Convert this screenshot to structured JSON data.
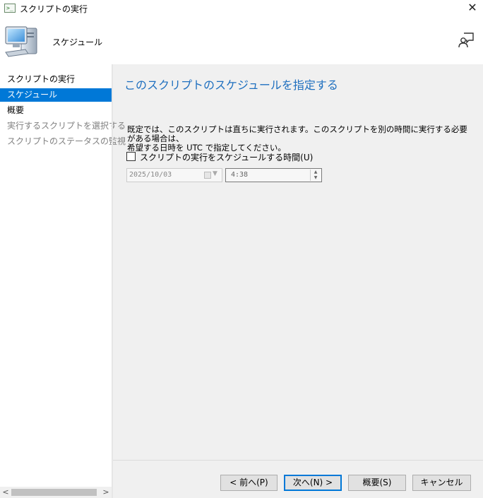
{
  "window": {
    "title": "スクリプトの実行",
    "close_label": "✕"
  },
  "header": {
    "title": "スケジュール"
  },
  "sidebar": {
    "items": [
      {
        "label": "スクリプトの実行",
        "state": "normal"
      },
      {
        "label": "スケジュール",
        "state": "active"
      },
      {
        "label": "概要",
        "state": "normal"
      },
      {
        "label": "実行するスクリプトを選択する",
        "state": "disabled"
      },
      {
        "label": "スクリプトのステータスの監視",
        "state": "disabled"
      }
    ]
  },
  "main": {
    "title": "このスクリプトのスケジュールを指定する",
    "description_line1": "既定では、このスクリプトは直ちに実行されます。このスクリプトを別の時間に実行する必要がある場合は、",
    "description_line2": "希望する日時を UTC で指定してください。",
    "schedule_checkbox": {
      "label": "スクリプトの実行をスケジュールする時間(U)",
      "checked": false
    },
    "date_value": "2025/10/03",
    "time_value": "4:38"
  },
  "buttons": {
    "prev": "< 前へ(P)",
    "next": "次へ(N) >",
    "summary": "概要(S)",
    "cancel": "キャンセル"
  },
  "colors": {
    "accent": "#0078d7",
    "title_blue": "#1e6fbf"
  }
}
